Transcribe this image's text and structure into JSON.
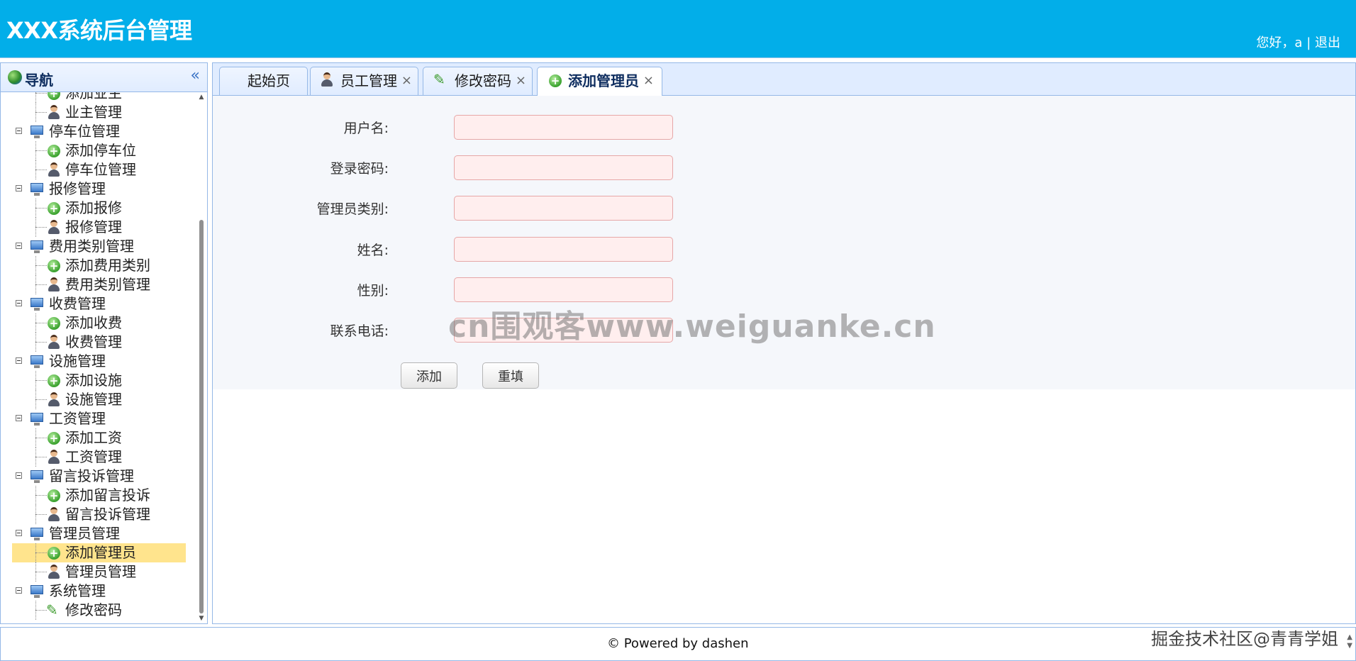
{
  "header": {
    "title": "XXX系统后台管理",
    "greeting": "您好，a",
    "separator": "|",
    "logout": "退出"
  },
  "sidebar": {
    "title": "导航",
    "collapse_icon": "«",
    "tree": [
      {
        "type": "child",
        "icon": "add-icon",
        "label": "添加业主"
      },
      {
        "type": "child",
        "icon": "user-icon",
        "label": "业主管理"
      },
      {
        "type": "parent",
        "label": "停车位管理"
      },
      {
        "type": "child",
        "icon": "add-icon",
        "label": "添加停车位"
      },
      {
        "type": "child",
        "icon": "user-icon",
        "label": "停车位管理"
      },
      {
        "type": "parent",
        "label": "报修管理"
      },
      {
        "type": "child",
        "icon": "add-icon",
        "label": "添加报修"
      },
      {
        "type": "child",
        "icon": "user-icon",
        "label": "报修管理"
      },
      {
        "type": "parent",
        "label": "费用类别管理"
      },
      {
        "type": "child",
        "icon": "add-icon",
        "label": "添加费用类别"
      },
      {
        "type": "child",
        "icon": "user-icon",
        "label": "费用类别管理"
      },
      {
        "type": "parent",
        "label": "收费管理"
      },
      {
        "type": "child",
        "icon": "add-icon",
        "label": "添加收费"
      },
      {
        "type": "child",
        "icon": "user-icon",
        "label": "收费管理"
      },
      {
        "type": "parent",
        "label": "设施管理"
      },
      {
        "type": "child",
        "icon": "add-icon",
        "label": "添加设施"
      },
      {
        "type": "child",
        "icon": "user-icon",
        "label": "设施管理"
      },
      {
        "type": "parent",
        "label": "工资管理"
      },
      {
        "type": "child",
        "icon": "add-icon",
        "label": "添加工资"
      },
      {
        "type": "child",
        "icon": "user-icon",
        "label": "工资管理"
      },
      {
        "type": "parent",
        "label": "留言投诉管理"
      },
      {
        "type": "child",
        "icon": "add-icon",
        "label": "添加留言投诉"
      },
      {
        "type": "child",
        "icon": "user-icon",
        "label": "留言投诉管理"
      },
      {
        "type": "parent",
        "label": "管理员管理"
      },
      {
        "type": "child",
        "icon": "add-icon",
        "label": "添加管理员",
        "selected": true
      },
      {
        "type": "child",
        "icon": "user-icon",
        "label": "管理员管理"
      },
      {
        "type": "parent",
        "label": "系统管理"
      },
      {
        "type": "child",
        "icon": "pencil-icon",
        "label": "修改密码"
      }
    ]
  },
  "tabs": [
    {
      "label": "起始页",
      "closable": false
    },
    {
      "label": "员工管理",
      "icon": "user-icon",
      "closable": true
    },
    {
      "label": "修改密码",
      "icon": "pencil-icon",
      "closable": true
    },
    {
      "label": "添加管理员",
      "icon": "add-icon",
      "closable": true,
      "active": true
    }
  ],
  "tab_close_glyph": "×",
  "form": {
    "fields": [
      {
        "label": "用户名:",
        "value": ""
      },
      {
        "label": "登录密码:",
        "value": ""
      },
      {
        "label": "管理员类别:",
        "value": ""
      },
      {
        "label": "姓名:",
        "value": ""
      },
      {
        "label": "性别:",
        "value": ""
      },
      {
        "label": "联系电话:",
        "value": ""
      }
    ],
    "submit_label": "添加",
    "reset_label": "重填"
  },
  "watermark": "cn围观客www.weiguanke.cn",
  "footer": {
    "text": "© Powered by dashen",
    "credit": "掘金技术社区@青青学姐"
  },
  "colors": {
    "header_bg": "#02aee9",
    "selected_row": "#ffe48d",
    "input_bg": "#ffeeee",
    "panel_border": "#95b8e7"
  }
}
